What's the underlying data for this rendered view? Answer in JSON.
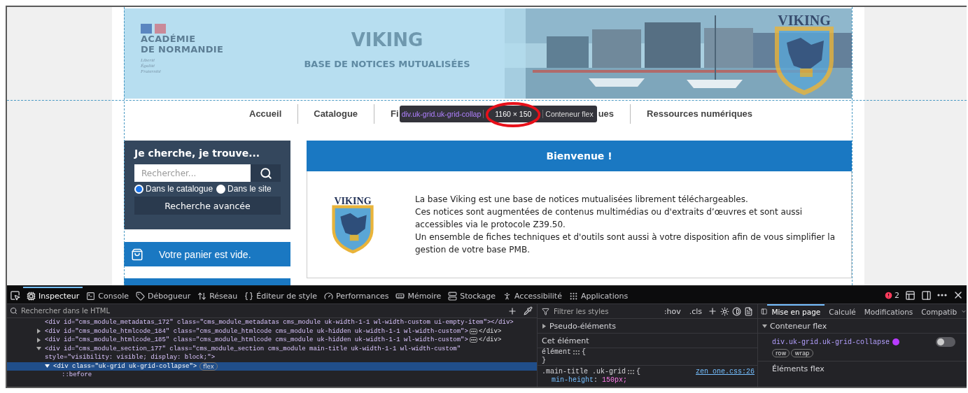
{
  "header": {
    "logo_lines": [
      "ACADÉMIE",
      "DE NORMANDIE"
    ],
    "motto": [
      "Liberté",
      "Égalité",
      "Fraternité"
    ],
    "title": "VIKING",
    "subtitle": "BASE DE NOTICES MUTUALISÉES",
    "badge_text": "VIKING"
  },
  "nav": {
    "items": [
      "Accueil",
      "Catalogue",
      "Fi",
      "ues",
      "Ressources numériques"
    ]
  },
  "tooltip": {
    "selector": "div.uk-grid.uk-grid-collap",
    "size": "1160 × 150",
    "type_label": "Conteneur flex"
  },
  "search_box": {
    "title": "Je cherche, je trouve...",
    "placeholder": "Rechercher...",
    "scopes": [
      {
        "label": "Dans le catalogue",
        "selected": true
      },
      {
        "label": "Dans le site",
        "selected": false
      }
    ],
    "advanced": "Recherche avancée"
  },
  "cart": {
    "text": "Votre panier est vide."
  },
  "welcome": {
    "title": "Bienvenue !",
    "logo_text": "VIKING",
    "paragraphs": [
      "La base Viking est une base de notices mutualisées librement téléchargeables.",
      "Ces notices sont augmentées de contenus multimédias ou d'extraits d’œuvres et sont aussi accessibles via le protocole Z39.50.",
      "Un ensemble de fiches techniques et d'outils sont aussi à votre disposition afin de vous simplifier la gestion de votre base PMB."
    ]
  },
  "devtools": {
    "tabs": [
      {
        "label": "Inspecteur",
        "selected": true
      },
      {
        "label": "Console",
        "selected": false
      },
      {
        "label": "Débogueur",
        "selected": false
      },
      {
        "label": "Réseau",
        "selected": false
      },
      {
        "label": "Éditeur de style",
        "selected": false
      },
      {
        "label": "Performances",
        "selected": false
      },
      {
        "label": "Mémoire",
        "selected": false
      },
      {
        "label": "Stockage",
        "selected": false
      },
      {
        "label": "Accessibilité",
        "selected": false
      },
      {
        "label": "Applications",
        "selected": false
      }
    ],
    "error_count": "2",
    "html_search": {
      "placeholder": "Rechercher dans le HTML"
    },
    "html_tree": [
      {
        "selected": false,
        "text": "<div id=\"cms_module_metadatas_172\" class=\"cms_module_metadatas cms_module uk-width-1-1 wl-width-custom ui-empty-item\"></div>"
      },
      {
        "expanded": false,
        "selected": false,
        "badge": true,
        "text": "<div id=\"cms_module_htmlcode_184\" class=\"cms_module_htmlcode cms_module uk-hidden uk-width-1-1 wl-width-custom\">",
        "closing": "</div>"
      },
      {
        "expanded": false,
        "selected": false,
        "badge": true,
        "text": "<div id=\"cms_module_htmlcode_185\" class=\"cms_module_htmlcode cms_module uk-hidden uk-width-1-1 wl-width-custom\">",
        "closing": "</div>"
      },
      {
        "expanded": true,
        "selected": false,
        "text": "<div id=\"cms_module_section_177\" class=\"cms_module_section cms_module main-title uk-width-1-1 wl-width-custom\"",
        "continuation": "style=\"visibility: visible; display: block;\">",
        "children": [
          {
            "expanded": true,
            "selected": true,
            "text": "<div class=\"uk-grid uk-grid-collapse\">",
            "pill": "flex",
            "children": [
              {
                "selected": false,
                "text": "::before"
              }
            ]
          }
        ]
      }
    ],
    "styles": {
      "filter_placeholder": "Filtrer les styles",
      "hov": ":hov",
      "cls": ".cls",
      "pseudo": "Pseudo-éléments",
      "this_element": "Cet élément",
      "element_rule": "élément",
      "open_brace": "{",
      "close_brace": "}",
      "rule_selector": ".main-title .uk-grid",
      "rule_source": "zen one.css:26",
      "prop_name": "min-height",
      "prop_sep": ":",
      "prop_value": "150px;"
    },
    "layout": {
      "tabs": [
        {
          "label": "Mise en page",
          "selected": true
        },
        {
          "label": "Calculé",
          "selected": false
        },
        {
          "label": "Modifications",
          "selected": false
        },
        {
          "label": "Compatib",
          "selected": false
        }
      ],
      "section": "Conteneur flex",
      "selector": "div.uk-grid.uk-grid-collapse",
      "color": "#b83bff",
      "pills": [
        "row",
        "wrap"
      ],
      "overlay_on": false,
      "flex_items": "Éléments flex"
    }
  }
}
